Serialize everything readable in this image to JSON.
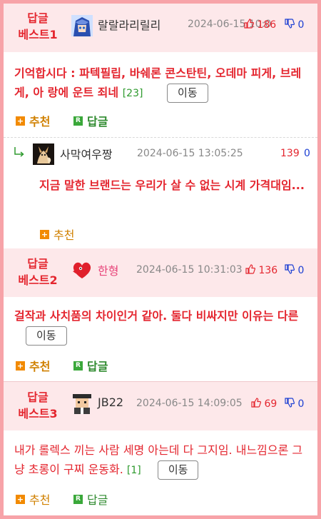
{
  "actions": {
    "recommend": "추천",
    "reply": "답글",
    "move": "이동"
  },
  "icons": {
    "up": "thumbs-up-icon",
    "down": "thumbs-down-icon",
    "arrow": "reply-arrow-icon"
  },
  "colors": {
    "accent": "#e4262f",
    "down": "#1c3fd3",
    "count": "#2e9a2e",
    "header_bg": "#fde8ea"
  },
  "best1": {
    "rank_top": "답글",
    "rank_bottom": "베스트1",
    "author": "랄랄라리릴리",
    "date": "2024-06-15 10:0",
    "up": "186",
    "down": "0",
    "content": "기억합시다 : 파텍필립, 바쉐론 콘스탄틴, 오데마 피게, 브레게, 아 랑에 운트 죄네",
    "count": "[23]"
  },
  "reply1": {
    "author": "사막여우짱",
    "date": "2024-06-15 13:05:25",
    "up": "139",
    "down": "0",
    "content": "지금 말한 브랜드는 우리가 살 수 없는 시계 가격대임..."
  },
  "best2": {
    "rank_top": "답글",
    "rank_bottom": "베스트2",
    "author": "한형",
    "date": "2024-06-15 10:31:03",
    "up": "136",
    "down": "0",
    "content": "걸작과 사치품의 차이인거 같아. 둘다 비싸지만 이유는 다른"
  },
  "best3": {
    "rank_top": "답글",
    "rank_bottom": "베스트3",
    "author": "JB22",
    "date": "2024-06-15 14:09:05",
    "up": "69",
    "down": "0",
    "content": "내가 롤렉스 끼는 사람 세명 아는데 다 그지임. 내느낌으론 그냥 초롱이 구찌 운동화.",
    "count": "[1]"
  }
}
